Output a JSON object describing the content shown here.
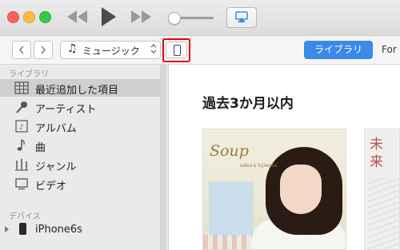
{
  "window": {
    "controls": [
      "close",
      "minimize",
      "zoom"
    ]
  },
  "player": {
    "prev_icon": "rewind-icon",
    "play_icon": "play-icon",
    "next_icon": "fast-forward-icon",
    "volume_level": 0.1,
    "airplay_icon": "airplay-icon"
  },
  "toolbar": {
    "back_icon": "chevron-left-icon",
    "forward_icon": "chevron-right-icon",
    "source_icon": "music-note-icon",
    "source_label": "ミュージック",
    "device_icon": "iphone-icon",
    "library_label": "ライブラリ",
    "for_you_label": "For"
  },
  "sidebar": {
    "library_header": "ライブラリ",
    "items": [
      {
        "label": "最近追加した項目",
        "icon": "grid-icon",
        "selected": true
      },
      {
        "label": "アーティスト",
        "icon": "microphone-icon"
      },
      {
        "label": "アルバム",
        "icon": "album-icon"
      },
      {
        "label": "曲",
        "icon": "music-note-icon"
      },
      {
        "label": "ジャンル",
        "icon": "genre-icon"
      },
      {
        "label": "ビデオ",
        "icon": "video-icon"
      }
    ],
    "devices_header": "デバイス",
    "device": {
      "label": "iPhone6s",
      "icon": "iphone-icon"
    }
  },
  "main": {
    "title": "過去3か月以内",
    "albums": [
      {
        "cover_text": "Soup",
        "cover_subtext": "sakura fujiwara"
      },
      {
        "cover_text": "未来"
      }
    ]
  },
  "colors": {
    "accent": "#3b89e8",
    "highlight": "#e8000b",
    "sidebar_bg": "#eaeaec"
  }
}
